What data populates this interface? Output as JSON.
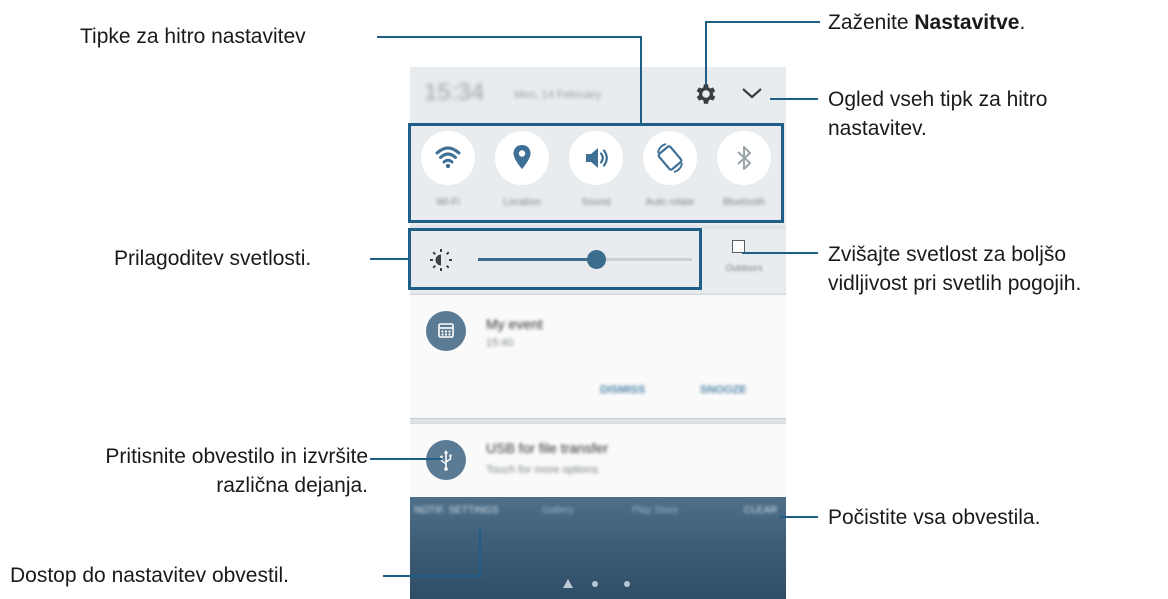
{
  "status_bar": {
    "time": "15:34",
    "date": "Mon, 14 February"
  },
  "quick_settings": [
    {
      "icon": "wifi-icon",
      "label": "Wi-Fi"
    },
    {
      "icon": "location-pin-icon",
      "label": "Location"
    },
    {
      "icon": "speaker-sound-icon",
      "label": "Sound"
    },
    {
      "icon": "auto-rotate-icon",
      "label": "Auto rotate"
    },
    {
      "icon": "bluetooth-icon",
      "label": "Bluetooth"
    }
  ],
  "brightness": {
    "level": 0.55,
    "outdoor_label": "Outdoors"
  },
  "notifications": [
    {
      "icon": "calendar-icon",
      "title": "My event",
      "subtitle": "15:40",
      "actions": [
        "DISMISS",
        "SNOOZE"
      ]
    },
    {
      "icon": "usb-icon",
      "title": "USB for file transfer",
      "subtitle": "Touch for more options."
    }
  ],
  "homescreen": {
    "notif_settings_label": "NOTIF. SETTINGS",
    "clear_label": "CLEAR",
    "apps": [
      "Gallery",
      "Play Store"
    ],
    "page_count": 3
  },
  "callouts": {
    "quick_buttons": "Tipke za hitro nastavitev",
    "launch_prefix": "Zaženite ",
    "launch_bold": "Nastavitve",
    "launch_suffix": ".",
    "view_all_line1": "Ogled vseh tipk za hitro",
    "view_all_line2": "nastavitev.",
    "brightness": "Prilagoditev svetlosti.",
    "outdoor_line1": "Zvišajte svetlost za boljšo",
    "outdoor_line2": "vidljivost pri svetlih pogojih.",
    "tap_line1": "Pritisnite obvestilo in izvršite",
    "tap_line2": "različna dejanja.",
    "clear_all": "Počistite vsa obvestila.",
    "notif_settings": "Dostop do nastavitev obvestil."
  },
  "colors": {
    "callout_line": "#1f5f87",
    "accent": "#3c6d8e",
    "icon_circle_fill": "#5b7a93"
  }
}
